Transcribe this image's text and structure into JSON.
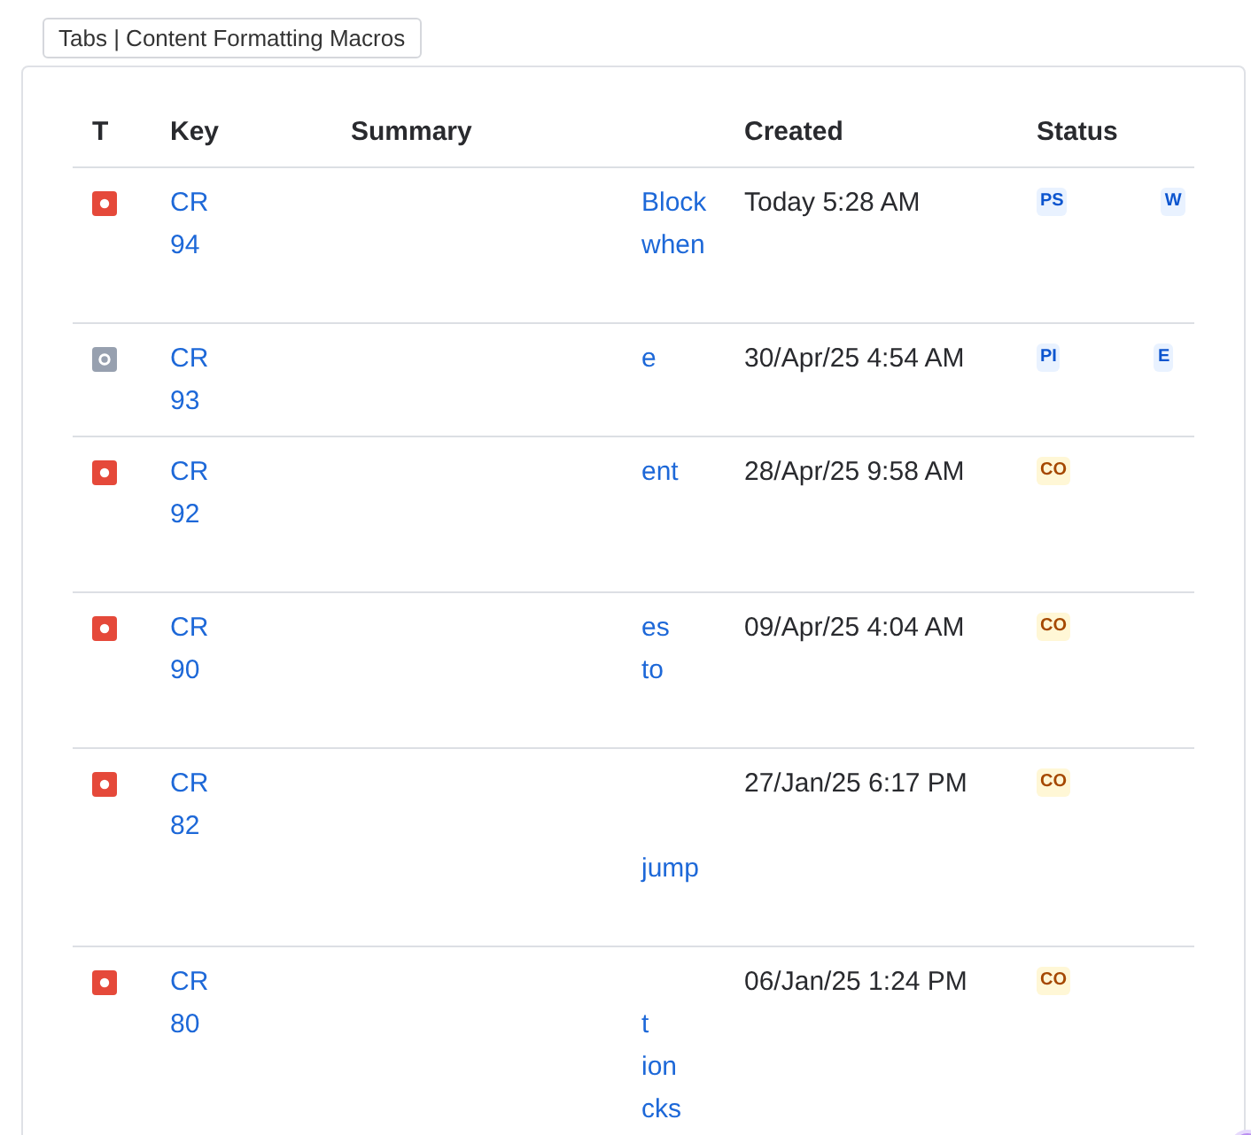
{
  "tab_label": "Tabs | Content Formatting Macros",
  "table": {
    "columns": [
      "T",
      "Key",
      "Summary",
      "Created",
      "Status"
    ],
    "rows": [
      {
        "kind": "bug",
        "key": [
          "CR",
          "94"
        ],
        "summary": [
          {
            "text": "Block"
          },
          {
            "text": "when"
          },
          {
            "kind": "blank"
          }
        ],
        "created": "Today 5:28 AM",
        "status": {
          "kind": "blue",
          "left": "PS",
          "right": "W"
        }
      },
      {
        "kind": "task",
        "key": [
          "CR",
          "93"
        ],
        "summary": [
          {
            "text": "e"
          },
          {
            "kind": "blank"
          }
        ],
        "created": "30/Apr/25 4:54 AM",
        "status": {
          "kind": "blue",
          "left": "PI",
          "right": "E"
        }
      },
      {
        "kind": "bug",
        "key": [
          "CR",
          "92"
        ],
        "summary": [
          {
            "text": "ent"
          },
          {
            "kind": "blank"
          },
          {
            "kind": "blank"
          }
        ],
        "created": "28/Apr/25 9:58 AM",
        "status": {
          "kind": "yellow",
          "left": "CO"
        }
      },
      {
        "kind": "bug",
        "key": [
          "CR",
          "90"
        ],
        "summary": [
          {
            "text": "es"
          },
          {
            "text": "to"
          },
          {
            "kind": "blank"
          }
        ],
        "created": "09/Apr/25 4:04 AM",
        "status": {
          "kind": "yellow",
          "left": "CO"
        }
      },
      {
        "kind": "bug",
        "key": [
          "CR",
          "82"
        ],
        "summary": [
          {
            "kind": "blank"
          },
          {
            "kind": "blank"
          },
          {
            "text": "jump"
          },
          {
            "kind": "blank"
          }
        ],
        "created": "27/Jan/25 6:17 PM",
        "status": {
          "kind": "yellow",
          "left": "CO"
        }
      },
      {
        "kind": "bug",
        "key": [
          "CR",
          "80"
        ],
        "summary": [
          {
            "kind": "blank"
          },
          {
            "text": "t"
          },
          {
            "text": "ion"
          },
          {
            "text": "cks"
          }
        ],
        "created": "06/Jan/25 1:24 PM",
        "status": {
          "kind": "yellow",
          "left": "CO"
        }
      }
    ]
  }
}
